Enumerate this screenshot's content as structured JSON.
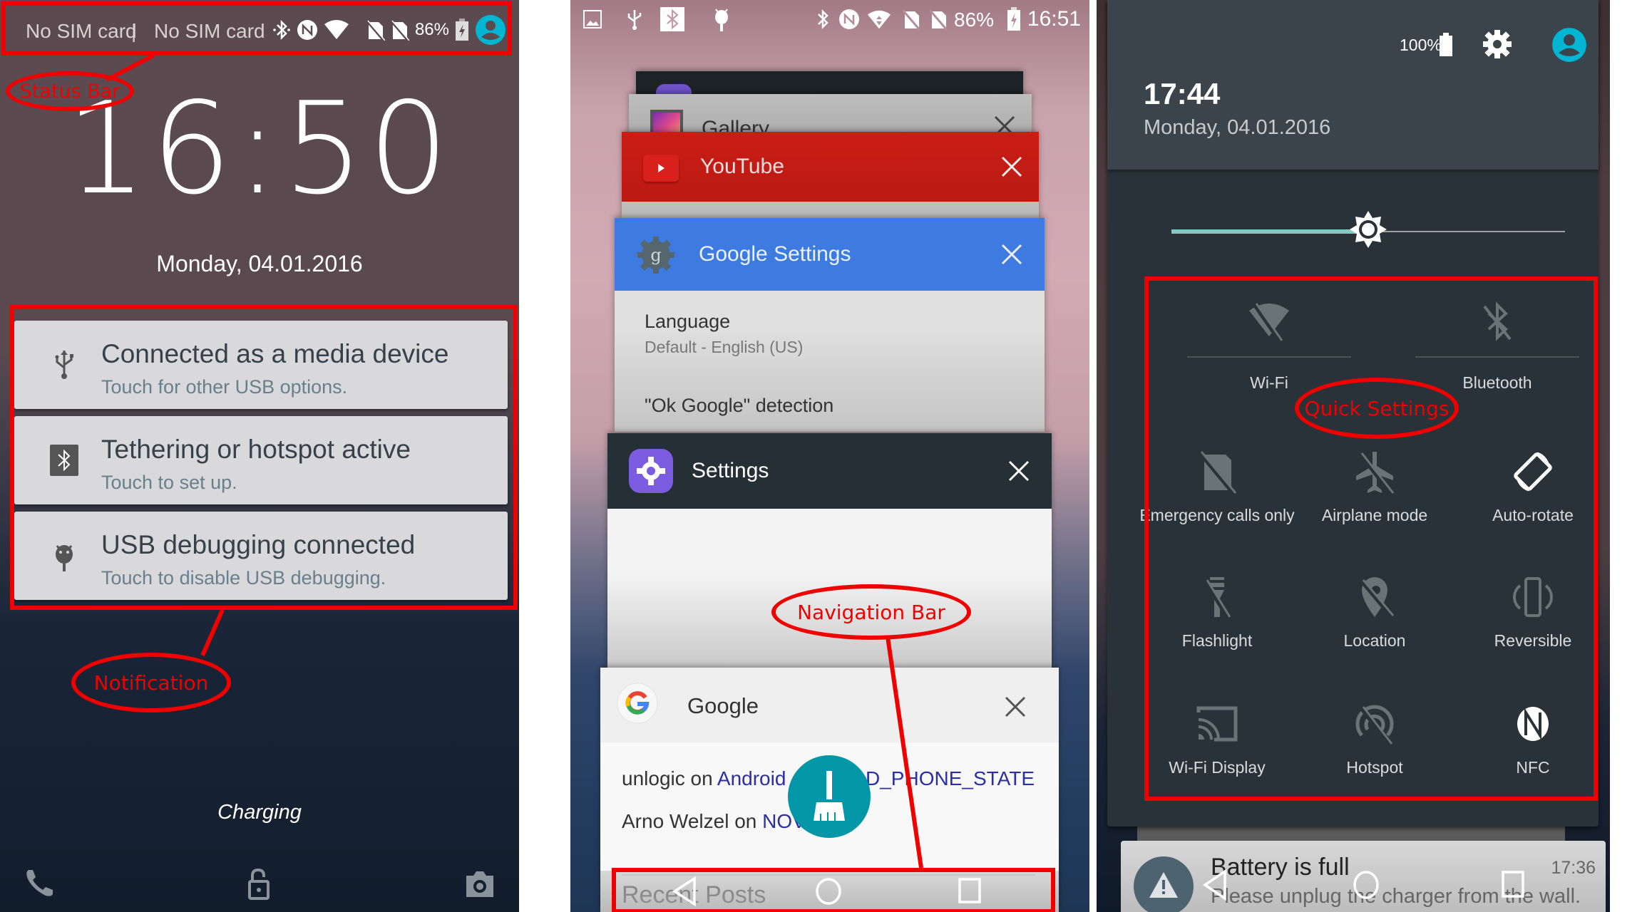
{
  "lock_screen": {
    "status_bar": {
      "carrier_1": "No SIM card",
      "separator": "|",
      "carrier_2": "No SIM card",
      "icons": [
        "bluetooth-icon",
        "nfc-icon",
        "wifi-icon",
        "no-sim-icon",
        "no-sim-icon",
        "battery-charging-icon",
        "user-avatar-icon"
      ],
      "battery": "86%"
    },
    "clock": "16:50",
    "date": "Monday, 04.01.2016",
    "notifications": [
      {
        "icon": "usb-icon",
        "title": "Connected as a media device",
        "subtitle": "Touch for other USB options."
      },
      {
        "icon": "bluetooth-tether-icon",
        "title": "Tethering or hotspot active",
        "subtitle": "Touch to set up."
      },
      {
        "icon": "android-debug-icon",
        "title": "USB debugging connected",
        "subtitle": "Touch to disable USB debugging."
      }
    ],
    "charging": "Charging",
    "bottom_actions": [
      "phone-icon",
      "unlock-icon",
      "camera-icon"
    ]
  },
  "recents": {
    "status_bar": {
      "left_icons": [
        "image-icon",
        "usb-icon",
        "bluetooth-icon",
        "android-debug-icon"
      ],
      "right_icons": [
        "bluetooth-icon",
        "nfc-icon",
        "wifi-icon",
        "no-sim-icon",
        "no-sim-icon",
        "battery-charging-icon"
      ],
      "battery": "86%",
      "time": "16:51"
    },
    "cards": [
      {
        "app": "Settings",
        "partial": true
      },
      {
        "app": "Gallery"
      },
      {
        "app": "YouTube"
      },
      {
        "app": "Google Settings",
        "items": [
          {
            "title": "Language",
            "subtitle": "Default - English (US)"
          },
          {
            "title": "\"Ok Google\" detection"
          }
        ]
      },
      {
        "app": "Settings"
      },
      {
        "app": "Google",
        "lines": [
          {
            "prefix": "unlogic on ",
            "link": "Android",
            "suffix_link": "D_PHONE_STATE"
          },
          {
            "prefix": "Arno Welzel on ",
            "link": "NOV"
          }
        ],
        "section": "Recent Posts"
      }
    ],
    "clear_all_button": "broom-icon",
    "nav_bar": {
      "back": "back-icon",
      "home": "home-icon",
      "recents": "recents-icon"
    }
  },
  "quick_settings": {
    "header": {
      "battery": "100%",
      "time": "17:44",
      "date": "Monday, 04.01.2016"
    },
    "brightness": {
      "level_percent": 50
    },
    "tiles": [
      {
        "label": "Wi-Fi",
        "icon": "wifi-off-icon",
        "active": false
      },
      {
        "label": "Bluetooth",
        "icon": "bluetooth-off-icon",
        "active": false
      },
      {
        "label": "Emergency calls only",
        "icon": "no-sim-icon",
        "active": false
      },
      {
        "label": "Airplane mode",
        "icon": "airplane-off-icon",
        "active": false
      },
      {
        "label": "Auto-rotate",
        "icon": "auto-rotate-icon",
        "active": true
      },
      {
        "label": "Flashlight",
        "icon": "flashlight-off-icon",
        "active": false
      },
      {
        "label": "Location",
        "icon": "location-off-icon",
        "active": false
      },
      {
        "label": "Reversible",
        "icon": "reversible-icon",
        "active": false
      },
      {
        "label": "Wi-Fi Display",
        "icon": "cast-icon",
        "active": false
      },
      {
        "label": "Hotspot",
        "icon": "hotspot-off-icon",
        "active": false
      },
      {
        "label": "NFC",
        "icon": "nfc-icon",
        "active": true
      }
    ],
    "notification": {
      "icon": "warning-icon",
      "title": "Battery is full",
      "subtitle": "Please unplug the charger from the wall.",
      "time": "17:36"
    }
  },
  "annotations": {
    "status_bar": "Status Bar",
    "notification": "Notification",
    "navigation_bar": "Navigation Bar",
    "quick_settings": "Quick Settings"
  },
  "colors": {
    "annotation": "#f10000",
    "accent_teal": "#00b6d3",
    "youtube_red": "#c91c14",
    "google_blue": "#3e7be0",
    "qs_background": "#283238",
    "qs_header": "#3b434b",
    "brightness_track": "#80cbc4"
  }
}
